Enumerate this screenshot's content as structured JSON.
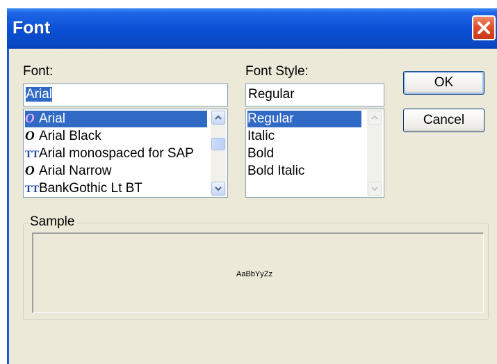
{
  "window": {
    "title": "Font"
  },
  "font": {
    "label": "Font:",
    "input_value": "Arial",
    "items": [
      {
        "icon": "opentype-icon",
        "name": "Arial",
        "selected": true
      },
      {
        "icon": "opentype-icon",
        "name": "Arial Black",
        "selected": false
      },
      {
        "icon": "truetype-icon",
        "name": "Arial monospaced for SAP",
        "selected": false
      },
      {
        "icon": "opentype-icon",
        "name": "Arial Narrow",
        "selected": false
      },
      {
        "icon": "truetype-icon",
        "name": "BankGothic Lt BT",
        "selected": false
      }
    ]
  },
  "style": {
    "label": "Font Style:",
    "input_value": "Regular",
    "items": [
      {
        "name": "Regular",
        "selected": true
      },
      {
        "name": "Italic",
        "selected": false
      },
      {
        "name": "Bold",
        "selected": false
      },
      {
        "name": "Bold Italic",
        "selected": false
      }
    ]
  },
  "buttons": {
    "ok": "OK",
    "cancel": "Cancel"
  },
  "sample": {
    "label": "Sample",
    "text": "AaBbYyZz"
  },
  "colors": {
    "title_bar": "#0a4fd3",
    "selection": "#316ac5",
    "dialog_bg": "#ece9d8",
    "close_button": "#e0502b"
  }
}
